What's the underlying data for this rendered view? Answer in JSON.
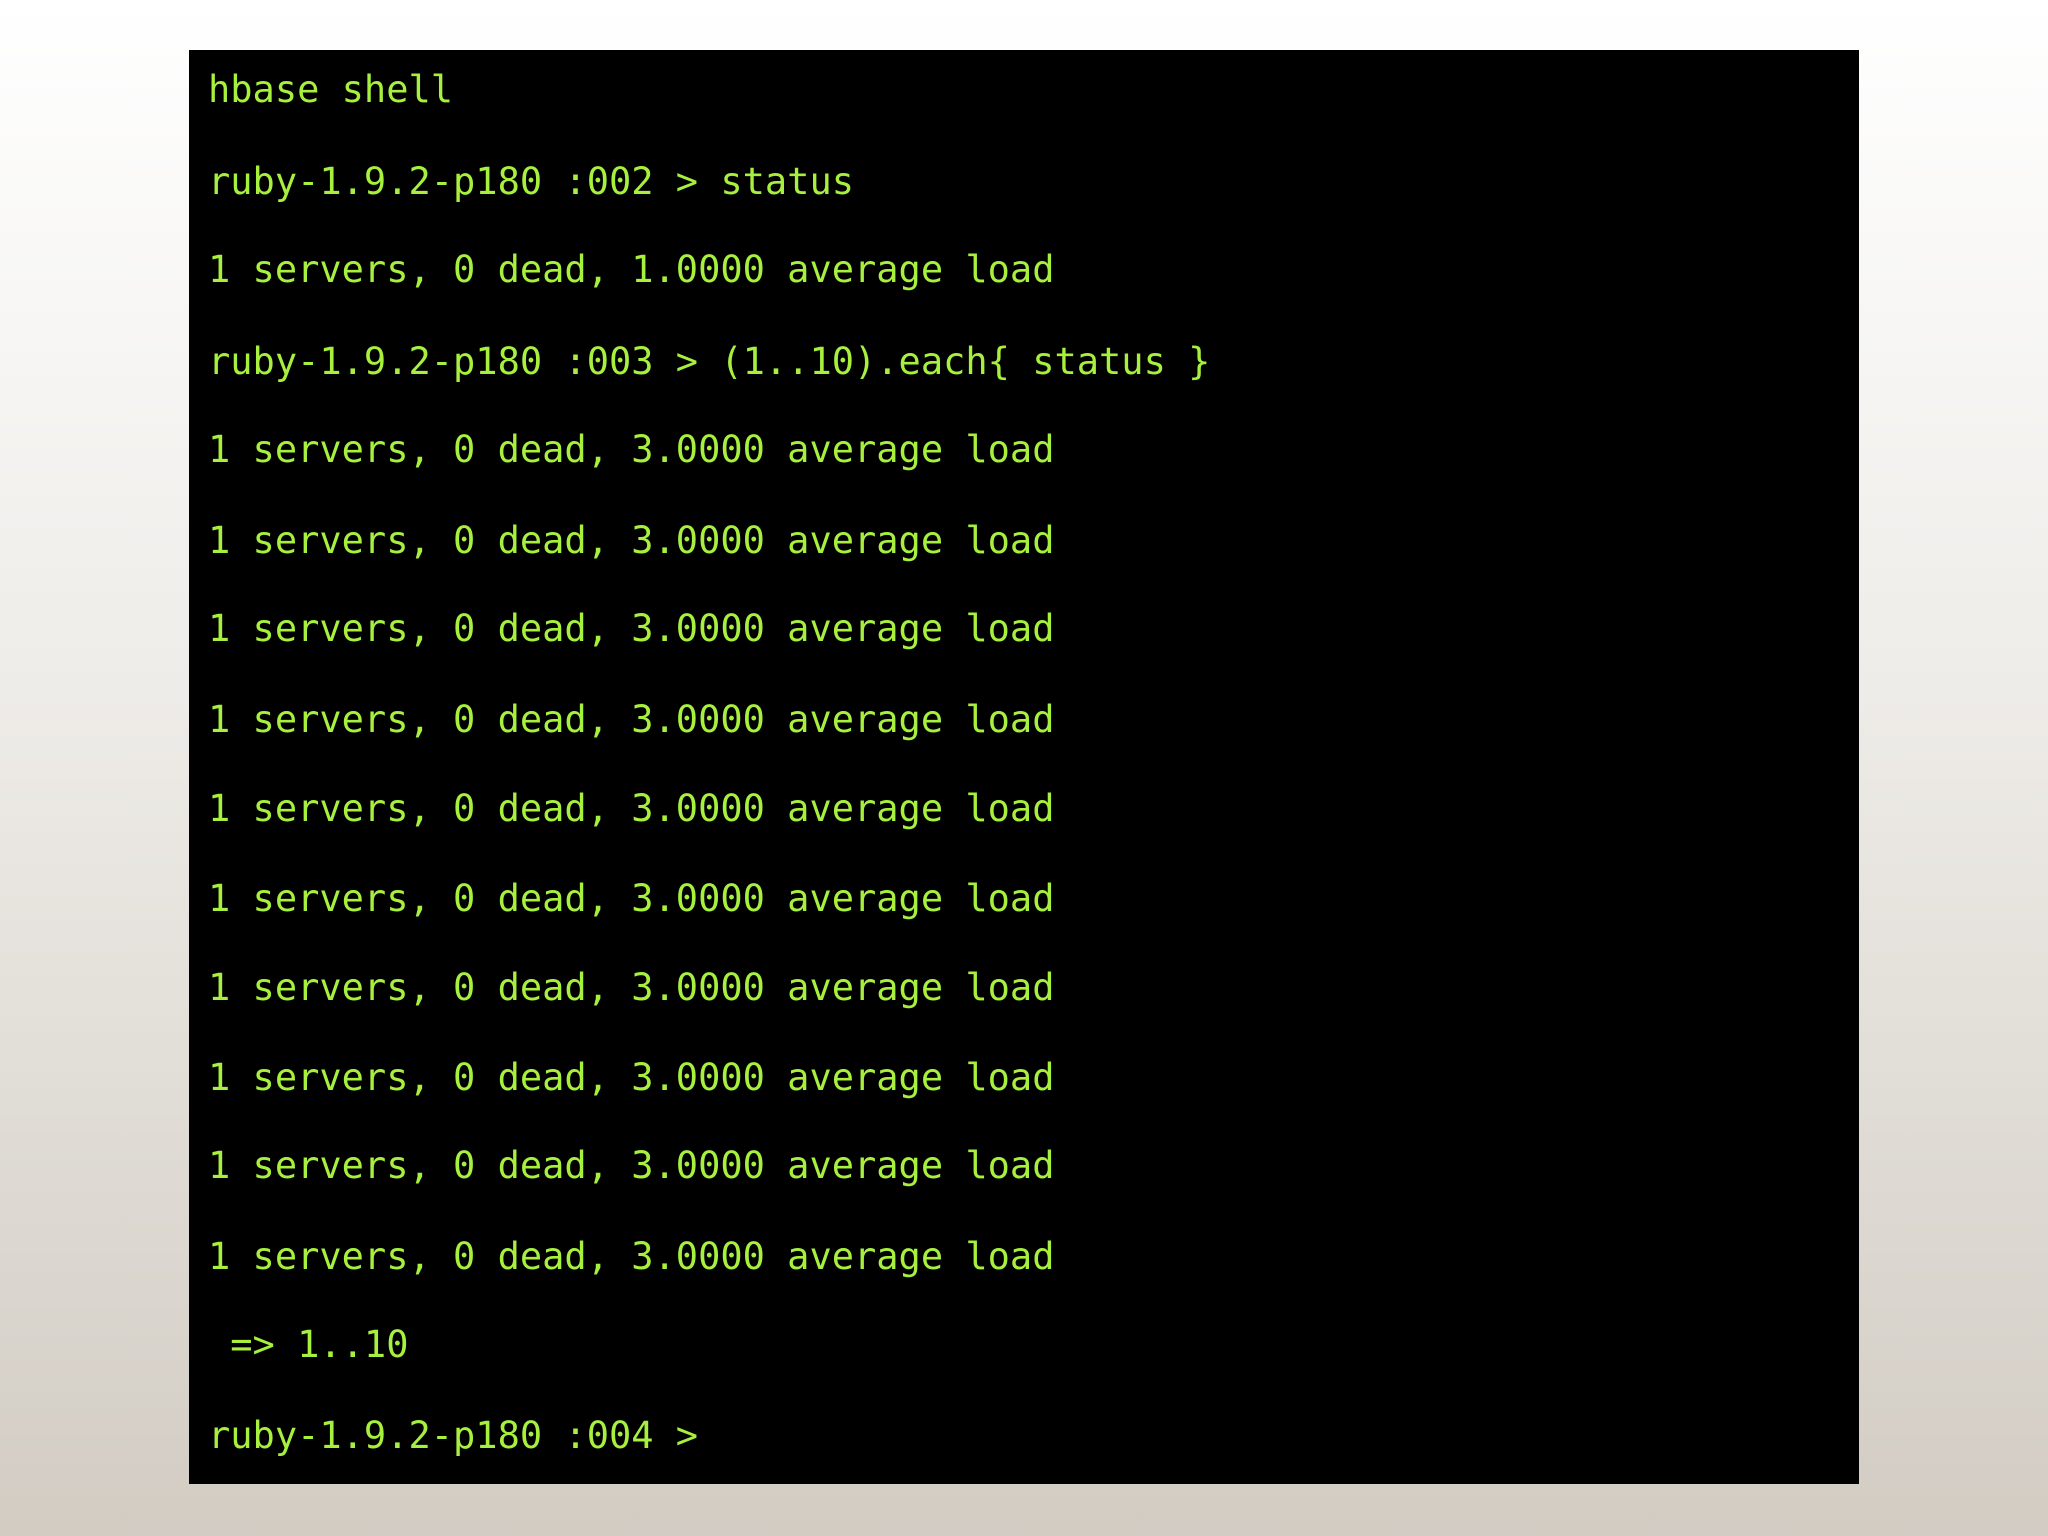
{
  "terminal": {
    "text_color": "#a7f03d",
    "background_color": "#000000",
    "lines": [
      "hbase shell",
      "ruby-1.9.2-p180 :002 > status",
      "1 servers, 0 dead, 1.0000 average load",
      "ruby-1.9.2-p180 :003 > (1..10).each{ status }",
      "1 servers, 0 dead, 3.0000 average load",
      "1 servers, 0 dead, 3.0000 average load",
      "1 servers, 0 dead, 3.0000 average load",
      "1 servers, 0 dead, 3.0000 average load",
      "1 servers, 0 dead, 3.0000 average load",
      "1 servers, 0 dead, 3.0000 average load",
      "1 servers, 0 dead, 3.0000 average load",
      "1 servers, 0 dead, 3.0000 average load",
      "1 servers, 0 dead, 3.0000 average load",
      "1 servers, 0 dead, 3.0000 average load",
      " => 1..10",
      "ruby-1.9.2-p180 :004 >"
    ]
  }
}
